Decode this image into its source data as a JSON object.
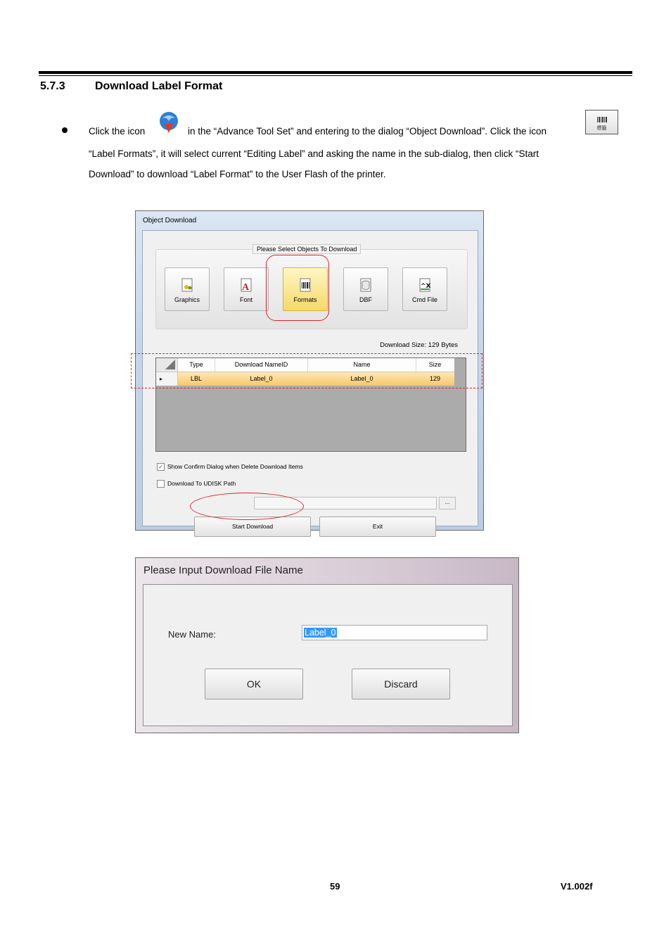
{
  "section": {
    "number": "5.7.3",
    "title": "Download Label Format"
  },
  "body": {
    "line1_a": "Click the icon",
    "line1_b": "in the “Advance Tool Set” and entering to the dialog “Object Download”. Click the icon",
    "line2": "“Label Formats”, it will select current “Editing Label” and asking the name in the sub-dialog, then click “Start",
    "line3": "Download” to download “Label Format” to the User Flash of the printer.",
    "label_icon_caption": "標籤"
  },
  "object_download": {
    "title": "Object Download",
    "group_caption": "Please Select Objects To Download",
    "objects": [
      "Graphics",
      "Font",
      "Formats",
      "DBF",
      "Cmd File"
    ],
    "selected_object": "Formats",
    "download_size": "Download Size: 129 Bytes",
    "columns": [
      "Type",
      "Download NameID",
      "Name",
      "Size"
    ],
    "rows": [
      {
        "type": "LBL",
        "name_id": "Label_0",
        "name": "Label_0",
        "size": "129"
      }
    ],
    "show_confirm": "Show Confirm Dialog when Delete Download Items",
    "show_confirm_checked": true,
    "udisk": "Download To UDISK Path",
    "udisk_checked": false,
    "browse": "...",
    "start": "Start Download",
    "exit": "Exit"
  },
  "input_dialog": {
    "title": "Please Input Download File Name",
    "new_name_label": "New Name:",
    "new_name_value": "Label_0",
    "ok": "OK",
    "discard": "Discard"
  },
  "footer": {
    "page": "59",
    "version": "V1.002f"
  }
}
